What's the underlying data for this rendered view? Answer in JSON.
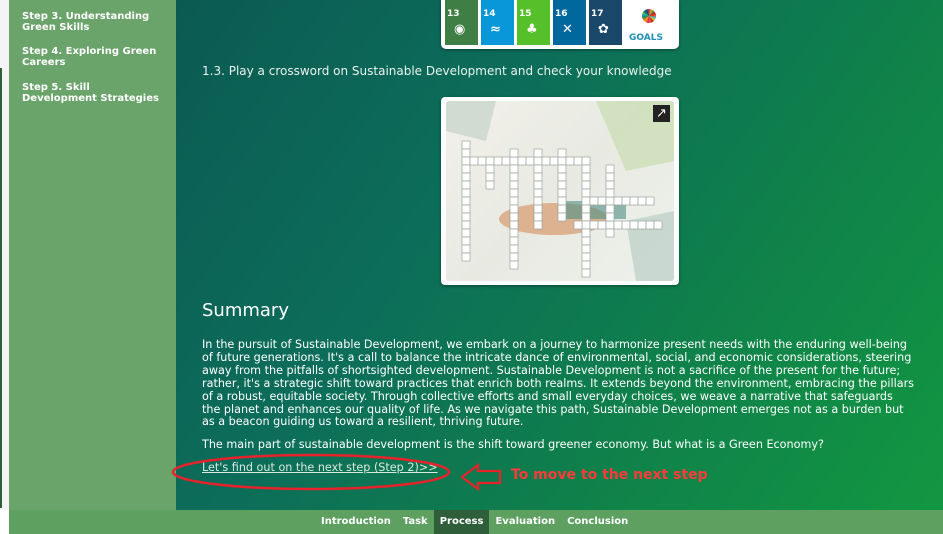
{
  "sidebar": {
    "items": [
      {
        "label": "Step 3. Understanding Green Skills"
      },
      {
        "label": "Step 4. Exploring Green Careers"
      },
      {
        "label": "Step 5. Skill Development Strategies"
      }
    ]
  },
  "sdg_strip": {
    "tiles": [
      {
        "num": "13",
        "color": "#3f7e44",
        "icon": "eye-icon"
      },
      {
        "num": "14",
        "color": "#0a97d9",
        "icon": "fish-icon"
      },
      {
        "num": "15",
        "color": "#56c02b",
        "icon": "tree-icon"
      },
      {
        "num": "16",
        "color": "#00689d",
        "icon": "dove-icon"
      },
      {
        "num": "17",
        "color": "#19486a",
        "icon": "flower-icon"
      }
    ],
    "goals_logo": "SUSTAINABLE DEVELOPMENT GOALS",
    "goals_word": "GOALS"
  },
  "content": {
    "caption": "1.3. Play a crossword on Sustainable Development and check your knowledge",
    "summary_title": "Summary",
    "summary_text": "In the pursuit of Sustainable Development, we embark on a journey to harmonize present needs with the enduring well-being of future generations. It's a call to balance the intricate dance of environmental, social, and economic considerations, steering away from the pitfalls of shortsighted development. Sustainable Development is not a sacrifice of the present for the future; rather, it's a strategic shift toward practices that enrich both realms. It extends beyond the environment, embracing the pillars of a robust, equitable society. Through collective efforts and small everyday choices, we weave a narrative that safeguards the planet and enhances our quality of life. As we navigate this path, Sustainable Development emerges not as a burden but as a beacon guiding us toward a resilient, thriving future.",
    "question": "The main part of sustainable development is the shift toward greener economy. But what is a Green Economy?",
    "next_link": "Let's find out on the next step (Step 2)>>",
    "annotation": "To move to the next step",
    "expand_glyph": "↗"
  },
  "footer": {
    "tabs": [
      {
        "label": "Introduction",
        "active": false
      },
      {
        "label": "Task",
        "active": false
      },
      {
        "label": "Process",
        "active": true
      },
      {
        "label": "Evaluation",
        "active": false
      },
      {
        "label": "Conclusion",
        "active": false
      }
    ]
  },
  "colors": {
    "accent_red": "#e8222b",
    "sidebar_green": "#6aa46b",
    "footer_active": "#2f5f3a"
  }
}
